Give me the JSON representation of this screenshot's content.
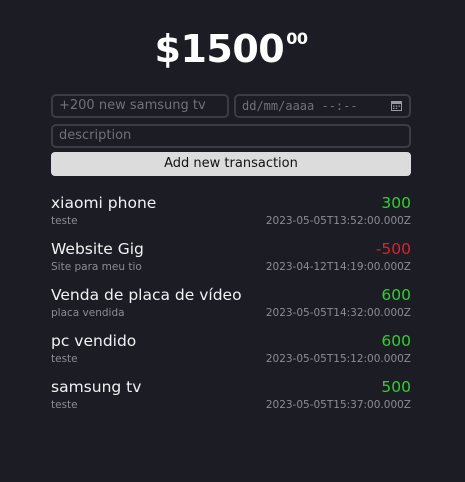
{
  "balance": {
    "integer": "$1500",
    "cents": "00"
  },
  "form": {
    "name_placeholder": "+200 new samsung tv",
    "date_placeholder": "dd/mm/aaaa --:--",
    "description_placeholder": "description",
    "submit_label": "Add new transaction"
  },
  "icons": {
    "calendar": "calendar-icon"
  },
  "colors": {
    "positive": "#2ad42a",
    "negative": "#e3202a"
  },
  "transactions": [
    {
      "name": "xiaomi phone",
      "amount": "300",
      "description": "teste",
      "datetime": "2023-05-05T13:52:00.000Z"
    },
    {
      "name": "Website Gig",
      "amount": "-500",
      "description": "Site para meu tio",
      "datetime": "2023-04-12T14:19:00.000Z"
    },
    {
      "name": "Venda de placa de vídeo",
      "amount": "600",
      "description": "placa vendida",
      "datetime": "2023-05-05T14:32:00.000Z"
    },
    {
      "name": "pc vendido",
      "amount": "600",
      "description": "teste",
      "datetime": "2023-05-05T15:12:00.000Z"
    },
    {
      "name": "samsung tv",
      "amount": "500",
      "description": "teste",
      "datetime": "2023-05-05T15:37:00.000Z"
    }
  ]
}
